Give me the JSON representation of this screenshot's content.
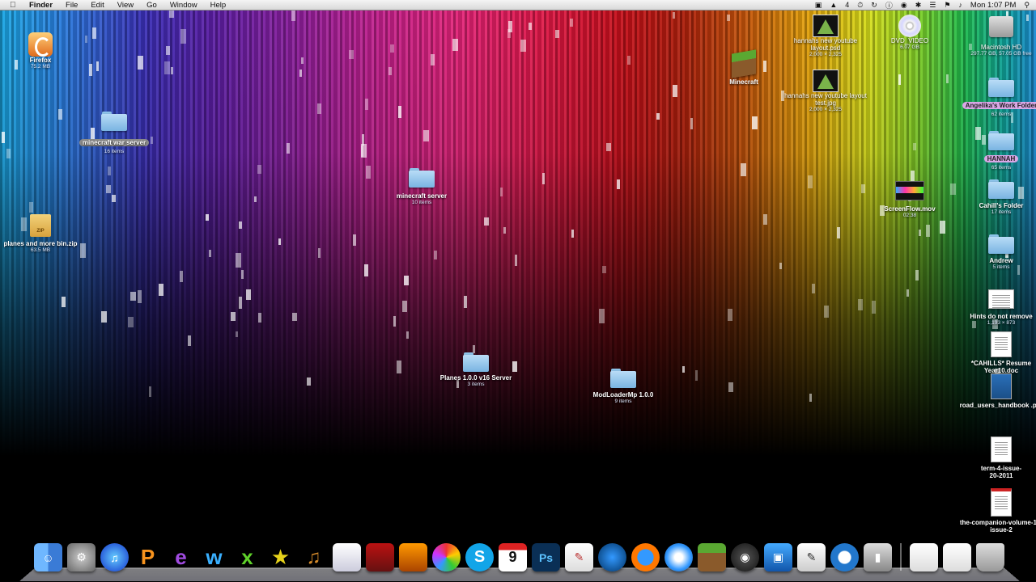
{
  "menubar": {
    "app": "Finder",
    "menus": [
      "File",
      "Edit",
      "View",
      "Go",
      "Window",
      "Help"
    ],
    "status_icons": [
      "screen-icon",
      "adobe-icon",
      "time-machine-icon",
      "sync-icon",
      "info-icon",
      "volume-icon",
      "bluetooth-icon",
      "wifi-icon",
      "flag-icon",
      "sound-icon"
    ],
    "adobe_count": "4",
    "clock": "Mon 1:07 PM"
  },
  "desktop": {
    "firefox": {
      "label": "Firefox",
      "sub": "75.2 MB"
    },
    "minecraft_war_server": {
      "label": "minecraft war server",
      "sub": "16 items"
    },
    "planes_zip": {
      "label": "planes and more bin.zip",
      "sub": "63.5 MB",
      "badge": "ZIP"
    },
    "minecraft_server": {
      "label": "minecraft server",
      "sub": "10 items"
    },
    "planes_server": {
      "label": "Planes 1.0.0 v16 Server",
      "sub": "3 items"
    },
    "modloader": {
      "label": "ModLoaderMp 1.0.0",
      "sub": "9 items"
    },
    "minecraft_app": {
      "label": "Minecraft"
    },
    "layout1": {
      "label": "hannahs new youtube layout.psd",
      "sub": "2,000 × 2,325"
    },
    "layout2": {
      "label": "hannahs new youtube layout test.jpg",
      "sub": "2,000 × 2,325"
    },
    "dvd": {
      "label": "DVD_VIDEO",
      "sub": "6.07 GB"
    },
    "screenflow": {
      "label": "ScreenFlow.mov",
      "sub": "02:38"
    },
    "macintosh_hd": {
      "label": "Macintosh HD",
      "sub": "297.77 GB, 57.05 GB free"
    },
    "angelika": {
      "label": "Angelika's Work Folder",
      "sub": "62 items"
    },
    "hannah": {
      "label": "HANNAH",
      "sub": "65 items"
    },
    "cahill": {
      "label": "Cahill's Folder",
      "sub": "17 items"
    },
    "andrew": {
      "label": "Andrew",
      "sub": "5 items"
    },
    "hints": {
      "label": "Hints do not remove",
      "sub": "1,193 × 873"
    },
    "resume": {
      "label": "*CAHILLS* Resume Year10.doc"
    },
    "road_users": {
      "label": "road_users_handbook .pdf"
    },
    "term4": {
      "label": "term-4-issue-20-2011"
    },
    "companion": {
      "label": "the-companion-volume-13-issue-2"
    }
  },
  "dock": {
    "calendar_day": "9",
    "photoshop_label": "Ps",
    "items": [
      "finder-icon",
      "system-preferences-icon",
      "itunes-icon",
      "pages-icon",
      "e-app-icon",
      "w-app-icon",
      "x-app-icon",
      "imovie-icon",
      "garageband-icon",
      "preview-icon",
      "photo-booth-icon",
      "iphoto-icon",
      "picasa-icon",
      "skype-icon",
      "ical-icon",
      "photoshop-icon",
      "textedit-icon",
      "google-earth-icon",
      "firefox-icon",
      "safari-icon",
      "minecraft-icon",
      "dashboard-icon",
      "screen-sharing-icon",
      "script-editor-icon",
      "quicktime-icon",
      "clapper-icon",
      "downloads-stack-icon",
      "documents-stack-icon",
      "trash-icon"
    ]
  }
}
